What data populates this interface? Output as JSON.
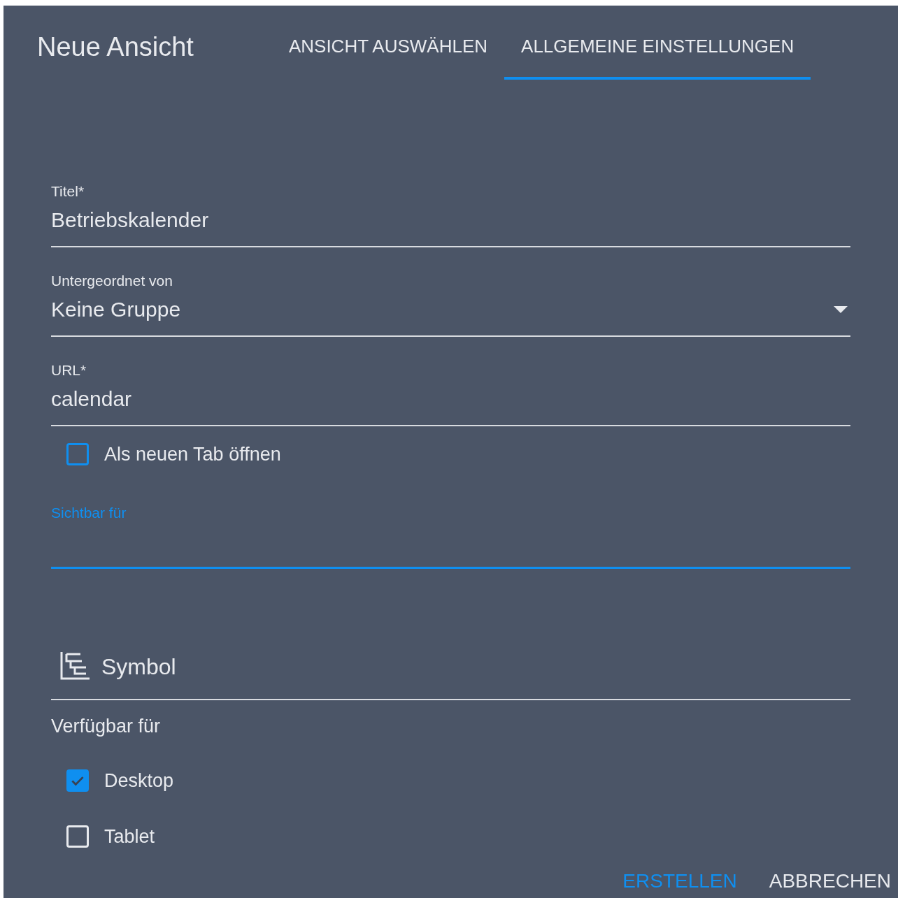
{
  "dialog": {
    "title": "Neue Ansicht"
  },
  "tabs": [
    {
      "label": "ANSICHT AUSWÄHLEN",
      "selected": false
    },
    {
      "label": "ALLGEMEINE EINSTELLUNGEN",
      "selected": true
    }
  ],
  "form": [
    {
      "kind": "text",
      "label": "Titel*",
      "value": "Betriebskalender",
      "focused": false
    },
    {
      "kind": "select",
      "label": "Untergeordnet von",
      "value": "Keine Gruppe",
      "focused": false
    },
    {
      "kind": "text",
      "label": "URL*",
      "value": "calendar",
      "focused": false
    },
    {
      "kind": "checkbox",
      "label": "Als neuen Tab öffnen",
      "checked": false,
      "focused": true
    },
    {
      "kind": "text",
      "label": "Sichtbar für",
      "focused": true
    },
    {
      "kind": "icon-picker",
      "label": "Symbol"
    }
  ],
  "available_for": {
    "label": "Verfügbar für",
    "options": [
      {
        "label": "Desktop",
        "checked": true
      },
      {
        "label": "Tablet",
        "checked": false
      }
    ]
  },
  "buttons": [
    {
      "label": "ERSTELLEN",
      "kind": "primary"
    },
    {
      "label": "ABBRECHEN",
      "kind": "plain"
    }
  ]
}
